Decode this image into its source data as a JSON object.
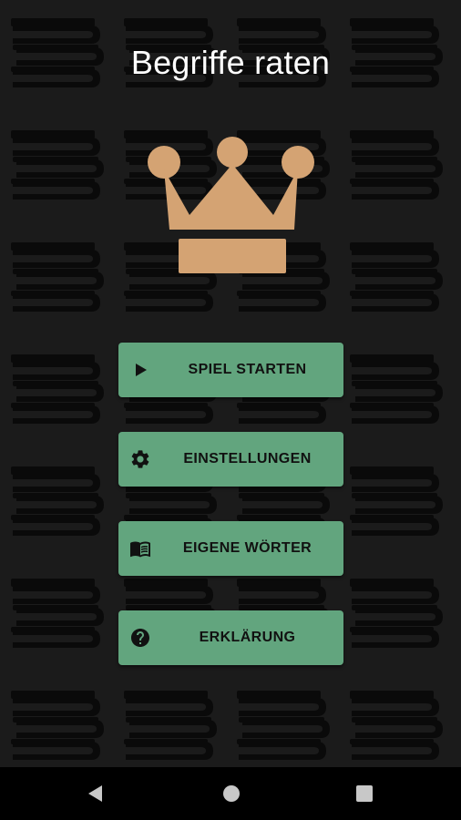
{
  "app": {
    "title": "Begriffe raten"
  },
  "logo": {
    "icon": "crown-icon",
    "color": "#d4a373"
  },
  "menu": {
    "buttons": [
      {
        "label": "SPIEL STARTEN",
        "icon": "play-icon"
      },
      {
        "label": "EINSTELLUNGEN",
        "icon": "gear-icon"
      },
      {
        "label": "EIGENE WÖRTER",
        "icon": "book-icon"
      },
      {
        "label": "ERKLÄRUNG",
        "icon": "help-icon"
      }
    ],
    "button_color": "#62a57e"
  },
  "background": {
    "pattern_icon": "books-icon",
    "color": "#1b1b1b"
  },
  "navbar": {
    "back_icon": "back-triangle-icon",
    "home_icon": "home-circle-icon",
    "recent_icon": "recent-square-icon"
  }
}
